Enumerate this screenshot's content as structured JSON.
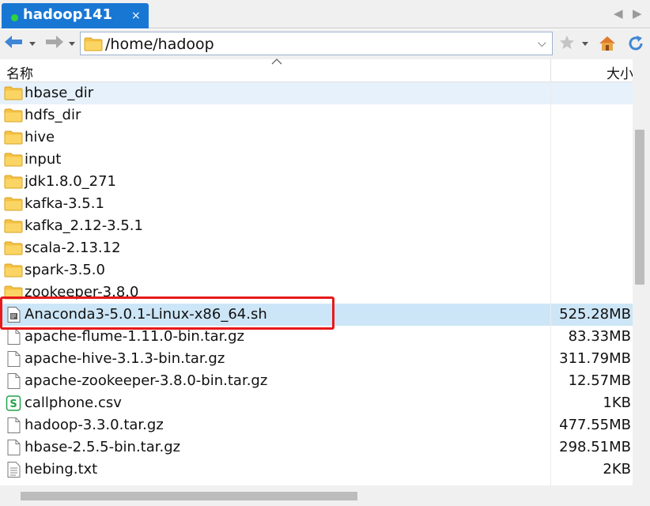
{
  "tab": {
    "title": "hadoop141",
    "close_glyph": "×",
    "prev_glyph": "◀",
    "next_glyph": "▶"
  },
  "address": {
    "path": "/home/hadoop",
    "dropdown_glyph": "⌵"
  },
  "icons": {
    "back": "back-arrow-icon",
    "forward": "forward-arrow-icon",
    "address_folder": "folder-icon",
    "favorite": "star-icon",
    "home": "home-icon",
    "refresh": "refresh-icon"
  },
  "columns": {
    "name": "名称",
    "size": "大小"
  },
  "rows": [
    {
      "name": "hbase_dir",
      "size": "",
      "icon": "folder"
    },
    {
      "name": "hdfs_dir",
      "size": "",
      "icon": "folder"
    },
    {
      "name": "hive",
      "size": "",
      "icon": "folder"
    },
    {
      "name": "input",
      "size": "",
      "icon": "folder"
    },
    {
      "name": "jdk1.8.0_271",
      "size": "",
      "icon": "folder"
    },
    {
      "name": "kafka-3.5.1",
      "size": "",
      "icon": "folder"
    },
    {
      "name": "kafka_2.12-3.5.1",
      "size": "",
      "icon": "folder"
    },
    {
      "name": "scala-2.13.12",
      "size": "",
      "icon": "folder"
    },
    {
      "name": "spark-3.5.0",
      "size": "",
      "icon": "folder"
    },
    {
      "name": "zookeeper-3.8.0",
      "size": "",
      "icon": "folder"
    },
    {
      "name": "Anaconda3-5.0.1-Linux-x86_64.sh",
      "size": "525.28MB",
      "icon": "script"
    },
    {
      "name": "apache-flume-1.11.0-bin.tar.gz",
      "size": "83.33MB",
      "icon": "file"
    },
    {
      "name": "apache-hive-3.1.3-bin.tar.gz",
      "size": "311.79MB",
      "icon": "file"
    },
    {
      "name": "apache-zookeeper-3.8.0-bin.tar.gz",
      "size": "12.57MB",
      "icon": "file"
    },
    {
      "name": "callphone.csv",
      "size": "1KB",
      "icon": "csv"
    },
    {
      "name": "hadoop-3.3.0.tar.gz",
      "size": "477.55MB",
      "icon": "file"
    },
    {
      "name": "hbase-2.5.5-bin.tar.gz",
      "size": "298.51MB",
      "icon": "file"
    },
    {
      "name": "hebing.txt",
      "size": "2KB",
      "icon": "text"
    }
  ],
  "colors": {
    "tab_active": "#1977d4",
    "selection": "#cde6f7",
    "hover": "#e6f1fb",
    "annotation_red": "#e8191a",
    "folder_yellow": "#f8c94a",
    "csv_green": "#22a34a"
  }
}
